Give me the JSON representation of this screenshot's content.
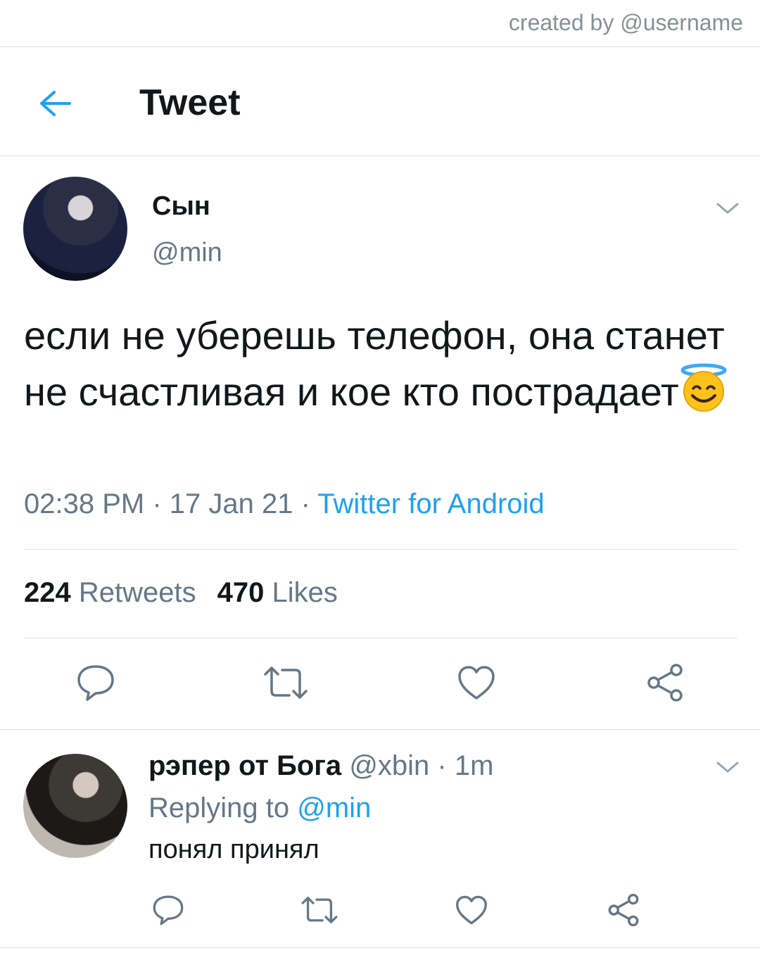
{
  "credit": "created by @username",
  "header": {
    "title": "Tweet"
  },
  "tweet": {
    "display_name": "Сын",
    "handle": "@min",
    "text": "если не уберешь телефон, она станет не счастливая и кое кто пострадает",
    "emoji": "smiling-face-with-halo",
    "time": "02:38 PM",
    "sep1": " · ",
    "date": "17 Jan 21",
    "sep2": " · ",
    "source": "Twitter for Android",
    "retweets_count": "224",
    "retweets_label": "Retweets",
    "likes_count": "470",
    "likes_label": "Likes"
  },
  "reply": {
    "display_name": "рэпер от Бога",
    "handle_time": "@xbin · 1m",
    "replying_prefix": "Replying to",
    "replying_to": "@min",
    "text": "понял принял"
  },
  "colors": {
    "accent": "#1da1f2",
    "muted": "#657786",
    "text": "#14171a",
    "divider": "#dfe3e6"
  },
  "icons": [
    "back-arrow-icon",
    "chevron-down-icon",
    "reply-icon",
    "retweet-icon",
    "like-icon",
    "share-icon"
  ]
}
